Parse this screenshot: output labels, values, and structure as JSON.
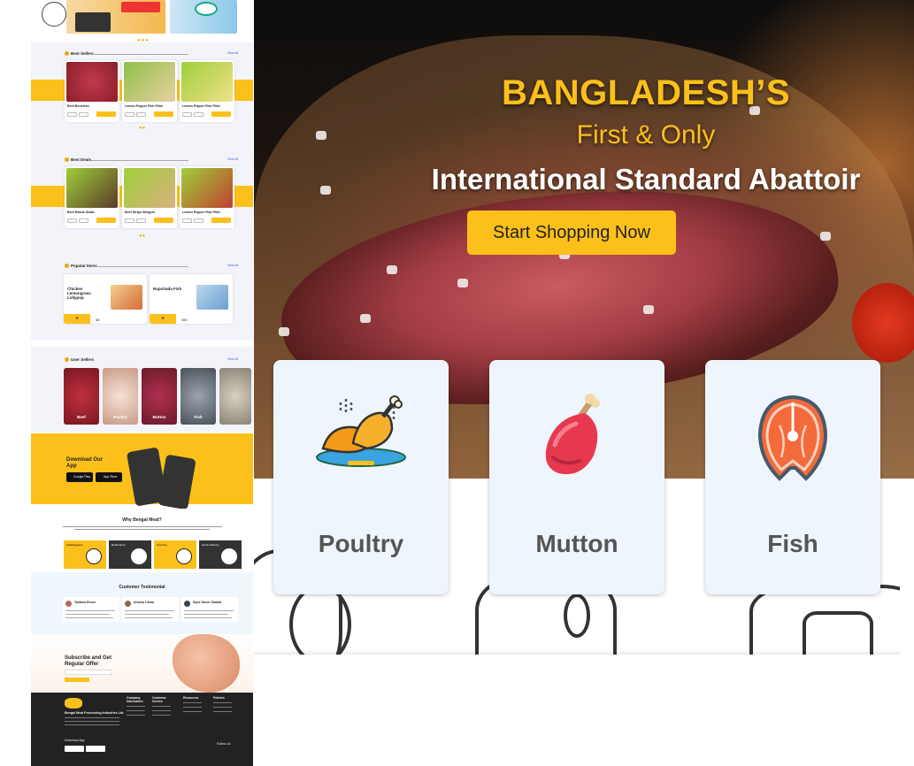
{
  "hero": {
    "line1": "BANGLADESH’S",
    "line2": "First & Only",
    "line3": "International Standard Abattoir",
    "cta_label": "Start Shopping Now"
  },
  "categories": [
    {
      "label": "Poultry",
      "icon": "poultry-icon"
    },
    {
      "label": "Mutton",
      "icon": "mutton-icon"
    },
    {
      "label": "Fish",
      "icon": "fish-icon"
    }
  ],
  "mobile": {
    "best_sellers": {
      "title": "Best Sellers",
      "view_all": "View All",
      "products": [
        "Beef Boneless",
        "Lemon Pepper Fish Fillet",
        "Lemon Pepper Fish Fillet"
      ]
    },
    "best_deals": {
      "title": "Best Deals",
      "view_all": "View All",
      "products": [
        "Beef Mincle Steak",
        "Beef Strips Slingers",
        "Lemon Pepper Fish Fillet"
      ]
    },
    "popular": {
      "title": "Popular Items",
      "view_all": "View All",
      "items": [
        "Chicken Lemongrass Lollypop",
        "Rupchada Fish"
      ],
      "prices": [
        "38",
        "390"
      ]
    },
    "categories": {
      "title": "User Sellers",
      "view_all": "View All",
      "items": [
        "Beef",
        "Poultry",
        "Mutton",
        "Fish"
      ]
    },
    "app": {
      "title": "Download Our App",
      "google_play": "Google Play",
      "app_store": "App Store"
    },
    "why": {
      "title": "Why Bengal Meat?",
      "boxes": [
        "Halal/Hygiene",
        "Retail Store",
        "Sourcing",
        "Home Delivery"
      ]
    },
    "testimonial": {
      "title": "Customer Testimonial",
      "names": [
        "Tanbina Emon",
        "Anisha Trisha",
        "Syed Tanvir Shahid"
      ]
    },
    "subscribe": {
      "title": "Subscribe and Get Regular Offer"
    },
    "footer": {
      "company": "Bengal Meat Processing Industries Ltd.",
      "col1": "Company Information",
      "col2": "Customer Service",
      "col3": "Resources",
      "col4": "Policies",
      "download": "Download App",
      "follow": "Follow Us"
    }
  }
}
